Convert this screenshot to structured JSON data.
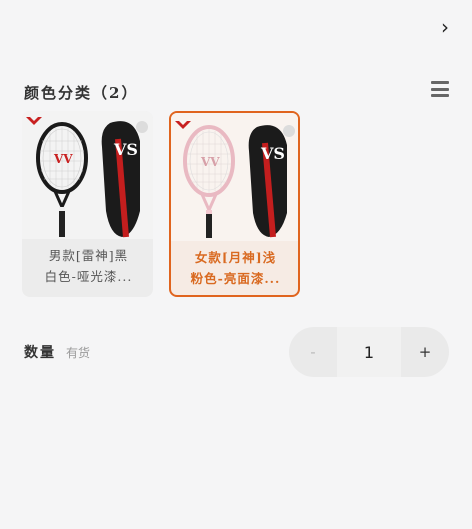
{
  "header": {
    "next_icon": "chevron-right-icon"
  },
  "color_section": {
    "title": "颜色分类（2）",
    "view_icon": "list-view-icon",
    "variants": [
      {
        "label_line1": "男款[雷神]黑",
        "label_line2": "白色-哑光漆...",
        "selected": false,
        "accent": "#222222"
      },
      {
        "label_line1": "女款[月神]浅",
        "label_line2": "粉色-亮面漆...",
        "selected": true,
        "accent": "#e0641e"
      }
    ]
  },
  "quantity": {
    "label": "数量",
    "stock": "有货",
    "minus": "-",
    "value": "1",
    "plus": "+"
  }
}
